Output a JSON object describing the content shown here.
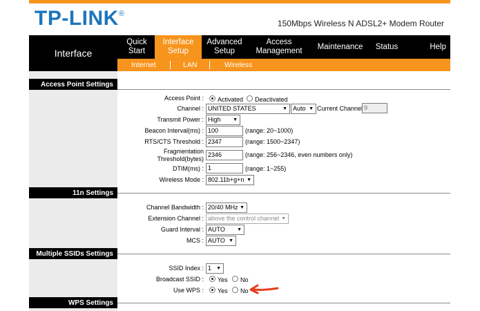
{
  "header": {
    "logo": "TP-LINK",
    "logo_mark": "®",
    "model": "150Mbps Wireless N ADSL2+ Modem Router"
  },
  "nav": {
    "current": "Interface",
    "items": [
      {
        "label": "Quick Start"
      },
      {
        "label": "Interface Setup"
      },
      {
        "label": "Advanced Setup"
      },
      {
        "label": "Access Management"
      },
      {
        "label": "Maintenance"
      },
      {
        "label": "Status"
      },
      {
        "label": "Help"
      }
    ],
    "subitems": [
      "Internet",
      "LAN",
      "Wireless"
    ]
  },
  "sections": {
    "ap": "Access Point Settings",
    "n11": "11n Settings",
    "ssid": "Multiple SSIDs Settings",
    "wps": "WPS Settings"
  },
  "ap": {
    "access_point_label": "Access Point :",
    "activated": "Activated",
    "deactivated": "Deactivated",
    "channel_label": "Channel :",
    "channel_value": "UNITED STATES",
    "channel_auto": "Auto",
    "current_channel_label": "Current Channel:",
    "current_channel_value": "9",
    "tx_power_label": "Transmit Power :",
    "tx_power_value": "High",
    "beacon_label": "Beacon Interval(ms) :",
    "beacon_value": "100",
    "beacon_range": "(range: 20~1000)",
    "rts_label": "RTS/CTS Threshold :",
    "rts_value": "2347",
    "rts_range": "(range: 1500~2347)",
    "frag_label_1": "Fragmentation",
    "frag_label_2": "Threshold(bytes)",
    "frag_value": "2346",
    "frag_range": "(range: 256~2346, even numbers only)",
    "dtim_label": "DTIM(ms) :",
    "dtim_value": "1",
    "dtim_range": "(range: 1~255)",
    "mode_label": "Wireless Mode :",
    "mode_value": "802.11b+g+n"
  },
  "n11": {
    "bandwidth_label": "Channel Bandwidth :",
    "bandwidth_value": "20/40 MHz",
    "ext_label": "Extension Channel :",
    "ext_value": "above the control channel",
    "guard_label": "Guard Interval :",
    "guard_value": "AUTO",
    "mcs_label": "MCS :",
    "mcs_value": "AUTO"
  },
  "ssid": {
    "index_label": "SSID Index :",
    "index_value": "1",
    "broadcast_label": "Broadcast SSID :",
    "wps_label": "Use WPS :",
    "yes": "Yes",
    "no": "No"
  },
  "colors": {
    "accent": "#f7941d",
    "brand": "#1c75bc",
    "annotation": "#e53c1c"
  }
}
